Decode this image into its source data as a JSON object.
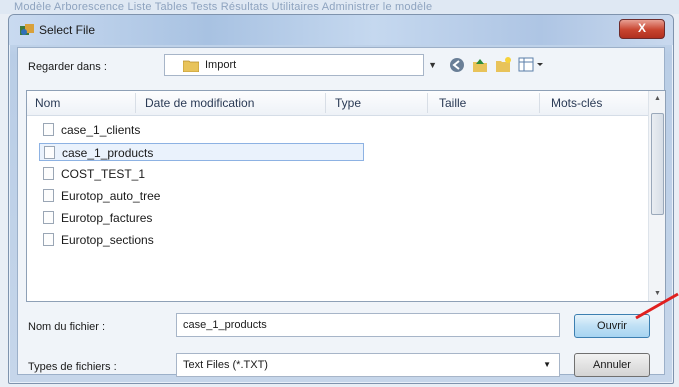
{
  "menu_bar": {
    "text": "Modèle  Arborescence  Liste  Tables  Tests  Résultats  Utilitaires  Administrer le modèle"
  },
  "dialog": {
    "title": "Select File",
    "close_label": "X",
    "look_in": {
      "label": "Regarder dans :",
      "value": "Import"
    },
    "toolbar_icons": [
      "back-icon",
      "up-folder-icon",
      "new-folder-icon",
      "view-menu-icon"
    ],
    "columns": [
      "Nom",
      "Date de modification",
      "Type",
      "Taille",
      "Mots-clés"
    ],
    "files": [
      {
        "name": "case_1_clients",
        "selected": false
      },
      {
        "name": "case_1_products",
        "selected": true
      },
      {
        "name": "COST_TEST_1",
        "selected": false
      },
      {
        "name": "Eurotop_auto_tree",
        "selected": false
      },
      {
        "name": "Eurotop_factures",
        "selected": false
      },
      {
        "name": "Eurotop_sections",
        "selected": false
      }
    ],
    "filename": {
      "label": "Nom du fichier :",
      "value": "case_1_products"
    },
    "filetype": {
      "label": "Types de fichiers :",
      "value": "Text Files (*.TXT)"
    },
    "open_button": "Ouvrir",
    "cancel_button": "Annuler"
  },
  "colors": {
    "accent": "#3c7fb1",
    "annotation_arrow": "#e02020",
    "close": "#c8442f"
  }
}
